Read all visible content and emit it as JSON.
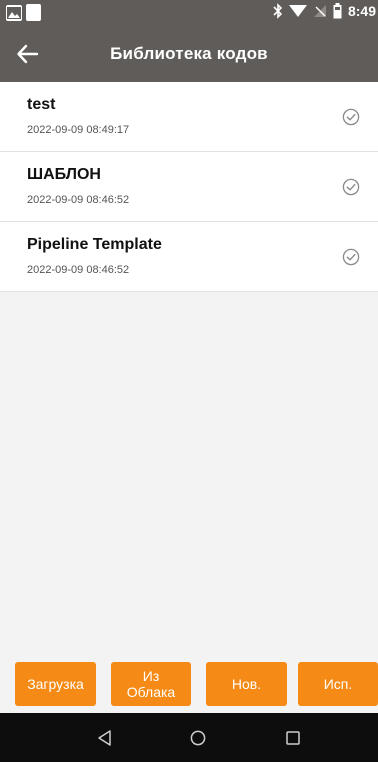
{
  "status_bar": {
    "time": "8:49",
    "icons": [
      "image-notification-icon",
      "blank-notification-icon",
      "bluetooth-icon",
      "wifi-icon",
      "no-sim-icon",
      "battery-icon"
    ]
  },
  "app_bar": {
    "title": "Библиотека кодов",
    "back_icon": "arrow-left-icon"
  },
  "items": [
    {
      "name": "test",
      "date": "2022-09-09 08:49:17",
      "icon": "check-circle-icon"
    },
    {
      "name": "ШАБЛОН",
      "date": "2022-09-09 08:46:52",
      "icon": "check-circle-icon"
    },
    {
      "name": "Pipeline Template",
      "date": "2022-09-09 08:46:52",
      "icon": "check-circle-icon"
    }
  ],
  "buttons": {
    "upload": "Загрузка",
    "from_cloud_line1": "Из",
    "from_cloud_line2": "Облака",
    "new": "Нов.",
    "use": "Исп."
  },
  "colors": {
    "app_bar": "#5f5c59",
    "accent": "#f58b16",
    "nav_bar": "#0d0d0d",
    "background": "#f3f3f3"
  },
  "nav_bar": {
    "icons": [
      "back-triangle-icon",
      "home-circle-icon",
      "recents-square-icon"
    ]
  }
}
